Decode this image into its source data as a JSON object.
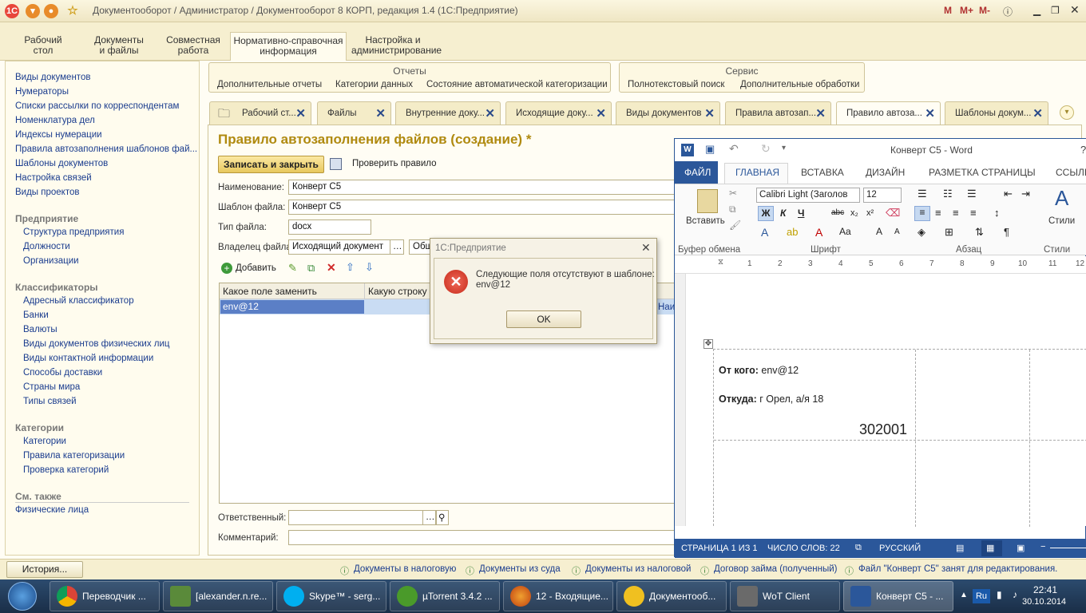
{
  "window_title": "Документооборот / Администратор / Документооборот 8 КОРП, редакция 1.4  (1С:Предприятие)",
  "title_right_buttons": [
    "M",
    "M+",
    "M-"
  ],
  "sections": [
    {
      "label": "Рабочий\nстол"
    },
    {
      "label": "Документы\nи файлы"
    },
    {
      "label": "Совместная\nработа"
    },
    {
      "label": "Нормативно-справочная\nинформация"
    },
    {
      "label": "Настройка и\nадминистрирование"
    }
  ],
  "nav": {
    "top_links": [
      "Виды документов",
      "Нумераторы",
      "Списки рассылки по корреспондентам",
      "Номенклатура дел",
      "Индексы нумерации",
      "Правила автозаполнения шаблонов фай...",
      "Шаблоны документов",
      "Настройка связей",
      "Виды проектов"
    ],
    "group1_title": "Предприятие",
    "group1": [
      "Структура предприятия",
      "Должности",
      "Организации"
    ],
    "group2_title": "Классификаторы",
    "group2": [
      "Адресный классификатор",
      "Банки",
      "Валюты",
      "Виды документов физических лиц",
      "Виды контактной информации",
      "Способы доставки",
      "Страны мира",
      "Типы связей"
    ],
    "group3_title": "Категории",
    "group3": [
      "Категории",
      "Правила категоризации",
      "Проверка категорий"
    ],
    "see_also_title": "См. также",
    "see_also": [
      "Физические лица"
    ]
  },
  "panels": {
    "reports_title": "Отчеты",
    "reports": [
      "Дополнительные отчеты",
      "Категории данных",
      "Состояние автоматической категоризации"
    ],
    "service_title": "Сервис",
    "service": [
      "Полнотекстовый поиск",
      "Дополнительные обработки"
    ]
  },
  "tabs": [
    "Рабочий ст...",
    "Файлы",
    "Внутренние доку...",
    "Исходящие доку...",
    "Виды документов",
    "Правила автозап...",
    "Правило автоза...",
    "Шаблоны докум..."
  ],
  "form": {
    "title": "Правило автозаполнения файлов (создание) *",
    "save_close": "Записать и закрыть",
    "check_rule": "Проверить правило",
    "name_label": "Наименование:",
    "name_value": "Конверт С5",
    "template_label": "Шаблон файла:",
    "template_value": "Конверт С5",
    "type_label": "Тип файла:",
    "type_value": "docx",
    "owner_label": "Владелец файла:",
    "owner_value": "Исходящий документ",
    "owner_value2": "Общ",
    "add_label": "Добавить",
    "col1": "Какое поле заменить",
    "col2": "Какую строку з",
    "col3": "Наи",
    "row1": "env@12",
    "responsible_label": "Ответственный:",
    "comment_label": "Комментарий:"
  },
  "modal": {
    "title": "1С:Предприятие",
    "message": "Следующие поля отсутствуют в шаблоне:\nenv@12",
    "ok": "OK"
  },
  "word": {
    "title": "Конверт С5 - Word",
    "help": "?",
    "tabs": [
      "ФАЙЛ",
      "ГЛАВНАЯ",
      "ВСТАВКА",
      "ДИЗАЙН",
      "РАЗМЕТКА СТРАНИЦЫ",
      "ССЫЛК"
    ],
    "paste": "Вставить",
    "styles": "Стили",
    "font_name": "Calibri Light (Заголов",
    "font_size": "12",
    "groups": [
      "Буфер обмена",
      "Шрифт",
      "Абзац",
      "Стили"
    ],
    "ruler_marks": [
      "1",
      "2",
      "3",
      "4",
      "5",
      "6",
      "7",
      "8",
      "9",
      "10",
      "11",
      "12"
    ],
    "from_label": "От кого:",
    "from_value": " env@12",
    "where_label": "Откуда:",
    "where_value": " г Орел, а/я 18",
    "zip": "302001",
    "status_page": "СТРАНИЦА 1 ИЗ 1",
    "status_words": "ЧИСЛО СЛОВ: 22",
    "status_lang": "РУССКИЙ"
  },
  "history_button": "История...",
  "history_links": [
    "Документы в налоговую",
    "Документы из суда",
    "Документы из налоговой",
    "Договор займа (полученный)",
    "Файл \"Конверт С5\" занят для редактирования."
  ],
  "taskbar": {
    "items": [
      "Переводчик ...",
      "[alexander.n.re...",
      "Skype™ - serg...",
      "µTorrent 3.4.2 ...",
      "12 - Входящие...",
      "Документооб...",
      "WoT Client",
      "Конверт С5 - ..."
    ],
    "lang": "Ru",
    "time": "22:41",
    "date": "30.10.2014"
  }
}
